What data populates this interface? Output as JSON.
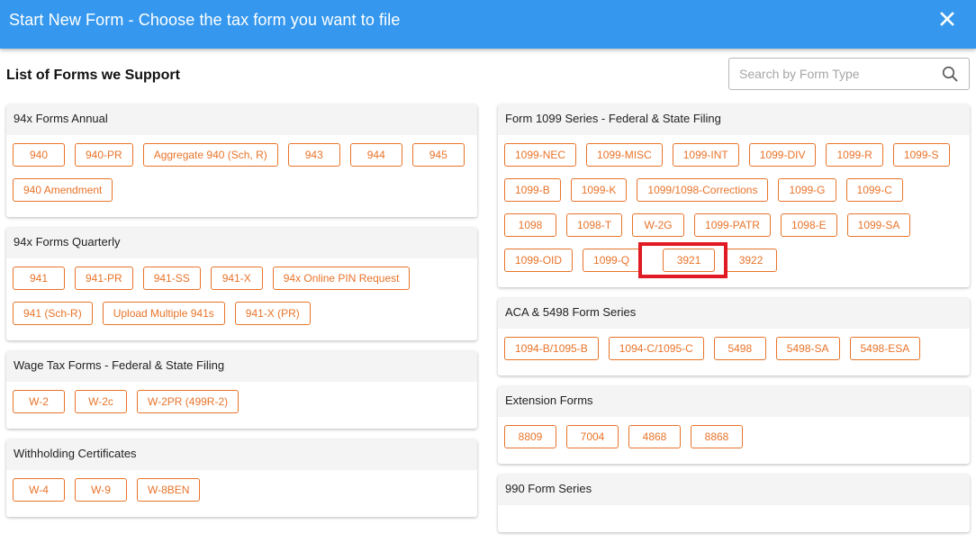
{
  "header": {
    "title": "Start New Form - Choose the tax form you want to file",
    "close_icon": "close-icon"
  },
  "page": {
    "list_title": "List of Forms we Support"
  },
  "search": {
    "placeholder": "Search by Form Type",
    "value": "",
    "icon": "search-icon"
  },
  "colors": {
    "header_bg": "#3598ee",
    "accent_orange": "#e8742a",
    "card_header_bg": "#f4f4f4",
    "highlight_red": "#e01b24"
  },
  "highlighted_form": "3921",
  "left_column": [
    {
      "title": "94x Forms Annual",
      "forms": [
        "940",
        "940-PR",
        "Aggregate 940 (Sch, R)",
        "943",
        "944",
        "945",
        "940 Amendment"
      ]
    },
    {
      "title": "94x Forms Quarterly",
      "forms": [
        "941",
        "941-PR",
        "941-SS",
        "941-X",
        "94x Online PIN Request",
        "941 (Sch-R)",
        "Upload Multiple 941s",
        "941-X (PR)"
      ]
    },
    {
      "title": "Wage Tax Forms - Federal & State Filing",
      "forms": [
        "W-2",
        "W-2c",
        "W-2PR (499R-2)"
      ]
    },
    {
      "title": "Withholding Certificates",
      "forms": [
        "W-4",
        "W-9",
        "W-8BEN"
      ]
    }
  ],
  "right_column": [
    {
      "title": "Form 1099 Series - Federal & State Filing",
      "forms": [
        "1099-NEC",
        "1099-MISC",
        "1099-INT",
        "1099-DIV",
        "1099-R",
        "1099-S",
        "1099-B",
        "1099-K",
        "1099/1098-Corrections",
        "1099-G",
        "1099-C",
        "1098",
        "1098-T",
        "W-2G",
        "1099-PATR",
        "1098-E",
        "1099-SA",
        "1099-OID",
        "1099-Q",
        "3921",
        "3922"
      ]
    },
    {
      "title": "ACA & 5498 Form Series",
      "forms": [
        "1094-B/1095-B",
        "1094-C/1095-C",
        "5498",
        "5498-SA",
        "5498-ESA"
      ]
    },
    {
      "title": "Extension Forms",
      "forms": [
        "8809",
        "7004",
        "4868",
        "8868"
      ]
    },
    {
      "title": "990 Form Series",
      "forms": []
    }
  ]
}
